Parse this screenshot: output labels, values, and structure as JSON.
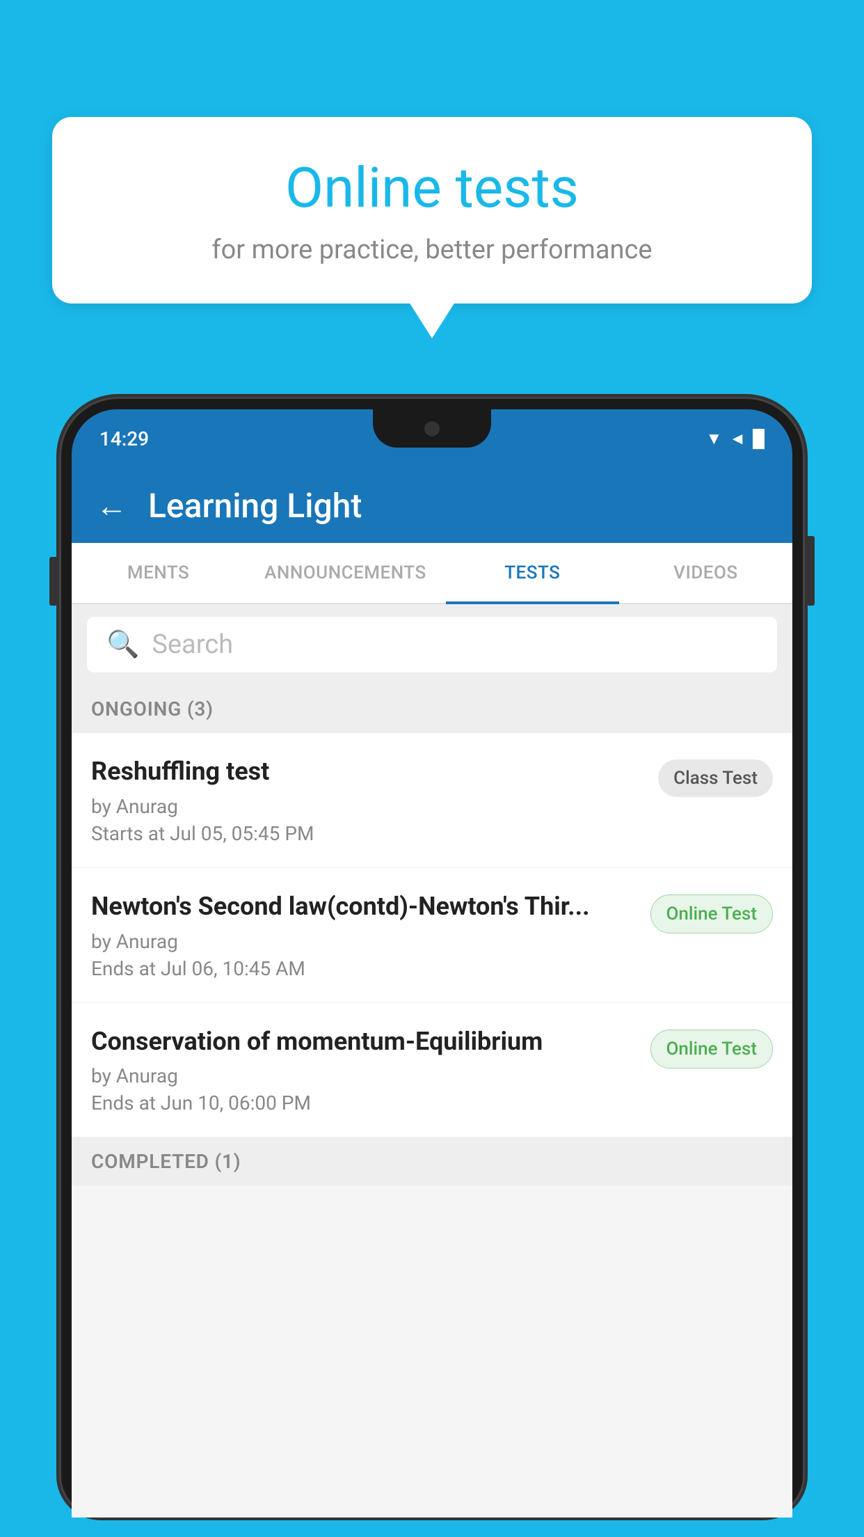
{
  "background_color": "#1ab8e8",
  "bubble": {
    "title": "Online tests",
    "subtitle": "for more practice, better performance"
  },
  "phone": {
    "status_time": "14:29",
    "signal_icons": "▼◄█"
  },
  "app": {
    "back_label": "←",
    "title": "Learning Light",
    "tabs": [
      {
        "label": "MENTS",
        "active": false
      },
      {
        "label": "ANNOUNCEMENTS",
        "active": false
      },
      {
        "label": "TESTS",
        "active": true
      },
      {
        "label": "VIDEOS",
        "active": false
      }
    ],
    "search_placeholder": "Search",
    "section_ongoing": "ONGOING (3)",
    "tests": [
      {
        "name": "Reshuffling test",
        "author": "by Anurag",
        "date": "Starts at  Jul 05, 05:45 PM",
        "badge": "Class Test",
        "badge_type": "class"
      },
      {
        "name": "Newton's Second law(contd)-Newton's Thir...",
        "author": "by Anurag",
        "date": "Ends at  Jul 06, 10:45 AM",
        "badge": "Online Test",
        "badge_type": "online"
      },
      {
        "name": "Conservation of momentum-Equilibrium",
        "author": "by Anurag",
        "date": "Ends at  Jun 10, 06:00 PM",
        "badge": "Online Test",
        "badge_type": "online"
      }
    ],
    "section_completed": "COMPLETED (1)"
  }
}
